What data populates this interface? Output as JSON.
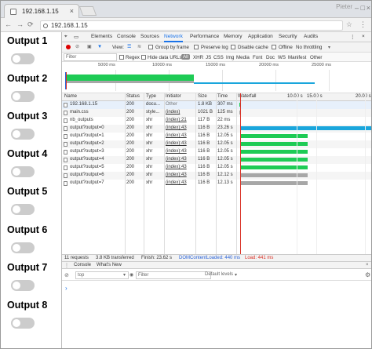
{
  "browser": {
    "tab_title": "192.168.1.15",
    "user": "Pieter",
    "url": "192.168.1.15"
  },
  "page": {
    "outputs": [
      "Output 1",
      "Output 2",
      "Output 3",
      "Output 4",
      "Output 5",
      "Output 6",
      "Output 7",
      "Output 8"
    ]
  },
  "devtools": {
    "tabs": [
      "Elements",
      "Console",
      "Sources",
      "Network",
      "Performance",
      "Memory",
      "Application",
      "Security",
      "Audits"
    ],
    "active_tab": "Network",
    "toolbar": {
      "view_label": "View:",
      "group": "Group by frame",
      "preserve": "Preserve log",
      "disable": "Disable cache",
      "offline": "Offline",
      "throttle": "No throttling"
    },
    "filter": {
      "placeholder": "Filter",
      "regex": "Regex",
      "hide": "Hide data URLs",
      "types": [
        "All",
        "XHR",
        "JS",
        "CSS",
        "Img",
        "Media",
        "Font",
        "Doc",
        "WS",
        "Manifest",
        "Other"
      ]
    },
    "overview_ticks": [
      "5000 ms",
      "10000 ms",
      "15000 ms",
      "20000 ms",
      "25000 ms"
    ],
    "columns": [
      "Name",
      "Status",
      "Type",
      "Initiator",
      "Size",
      "Time",
      "Waterfall"
    ],
    "waterfall_ticks": [
      "10.00 s",
      "15.00 s",
      "20.00 s"
    ],
    "rows": [
      {
        "name": "192.168.1.15",
        "status": "200",
        "type": "docu...",
        "initiator": "Other",
        "size": "1.8 KB",
        "time": "307 ms"
      },
      {
        "name": "main.css",
        "status": "200",
        "type": "style...",
        "initiator": "(index)",
        "size": "1021 B",
        "time": "125 ms"
      },
      {
        "name": "nb_outputs",
        "status": "200",
        "type": "xhr",
        "initiator": "(index):21",
        "size": "117 B",
        "time": "22 ms"
      },
      {
        "name": "output?output=0",
        "status": "200",
        "type": "xhr",
        "initiator": "(index):43",
        "size": "116 B",
        "time": "23.26 s"
      },
      {
        "name": "output?output=1",
        "status": "200",
        "type": "xhr",
        "initiator": "(index):43",
        "size": "116 B",
        "time": "12.05 s"
      },
      {
        "name": "output?output=2",
        "status": "200",
        "type": "xhr",
        "initiator": "(index):43",
        "size": "116 B",
        "time": "12.05 s"
      },
      {
        "name": "output?output=3",
        "status": "200",
        "type": "xhr",
        "initiator": "(index):43",
        "size": "116 B",
        "time": "12.05 s"
      },
      {
        "name": "output?output=4",
        "status": "200",
        "type": "xhr",
        "initiator": "(index):43",
        "size": "116 B",
        "time": "12.05 s"
      },
      {
        "name": "output?output=5",
        "status": "200",
        "type": "xhr",
        "initiator": "(index):43",
        "size": "116 B",
        "time": "12.05 s"
      },
      {
        "name": "output?output=6",
        "status": "200",
        "type": "xhr",
        "initiator": "(index):43",
        "size": "116 B",
        "time": "12.12 s"
      },
      {
        "name": "output?output=7",
        "status": "200",
        "type": "xhr",
        "initiator": "(index):43",
        "size": "116 B",
        "time": "12.13 s"
      }
    ],
    "summary": {
      "requests": "11 requests",
      "transferred": "3.8 KB transferred",
      "finish": "Finish: 23.62 s",
      "dom": "DOMContentLoaded: 440 ms",
      "load": "Load: 441 ms"
    },
    "console": {
      "tabs": [
        "Console",
        "What's New"
      ],
      "context": "top",
      "filter_placeholder": "Filter",
      "levels": "Default levels"
    }
  },
  "colors": {
    "accent": "#1a73e8",
    "waterfall_green": "#1ecb55",
    "waterfall_blue": "#1aa6dc",
    "grey": "#a7a7a7"
  }
}
